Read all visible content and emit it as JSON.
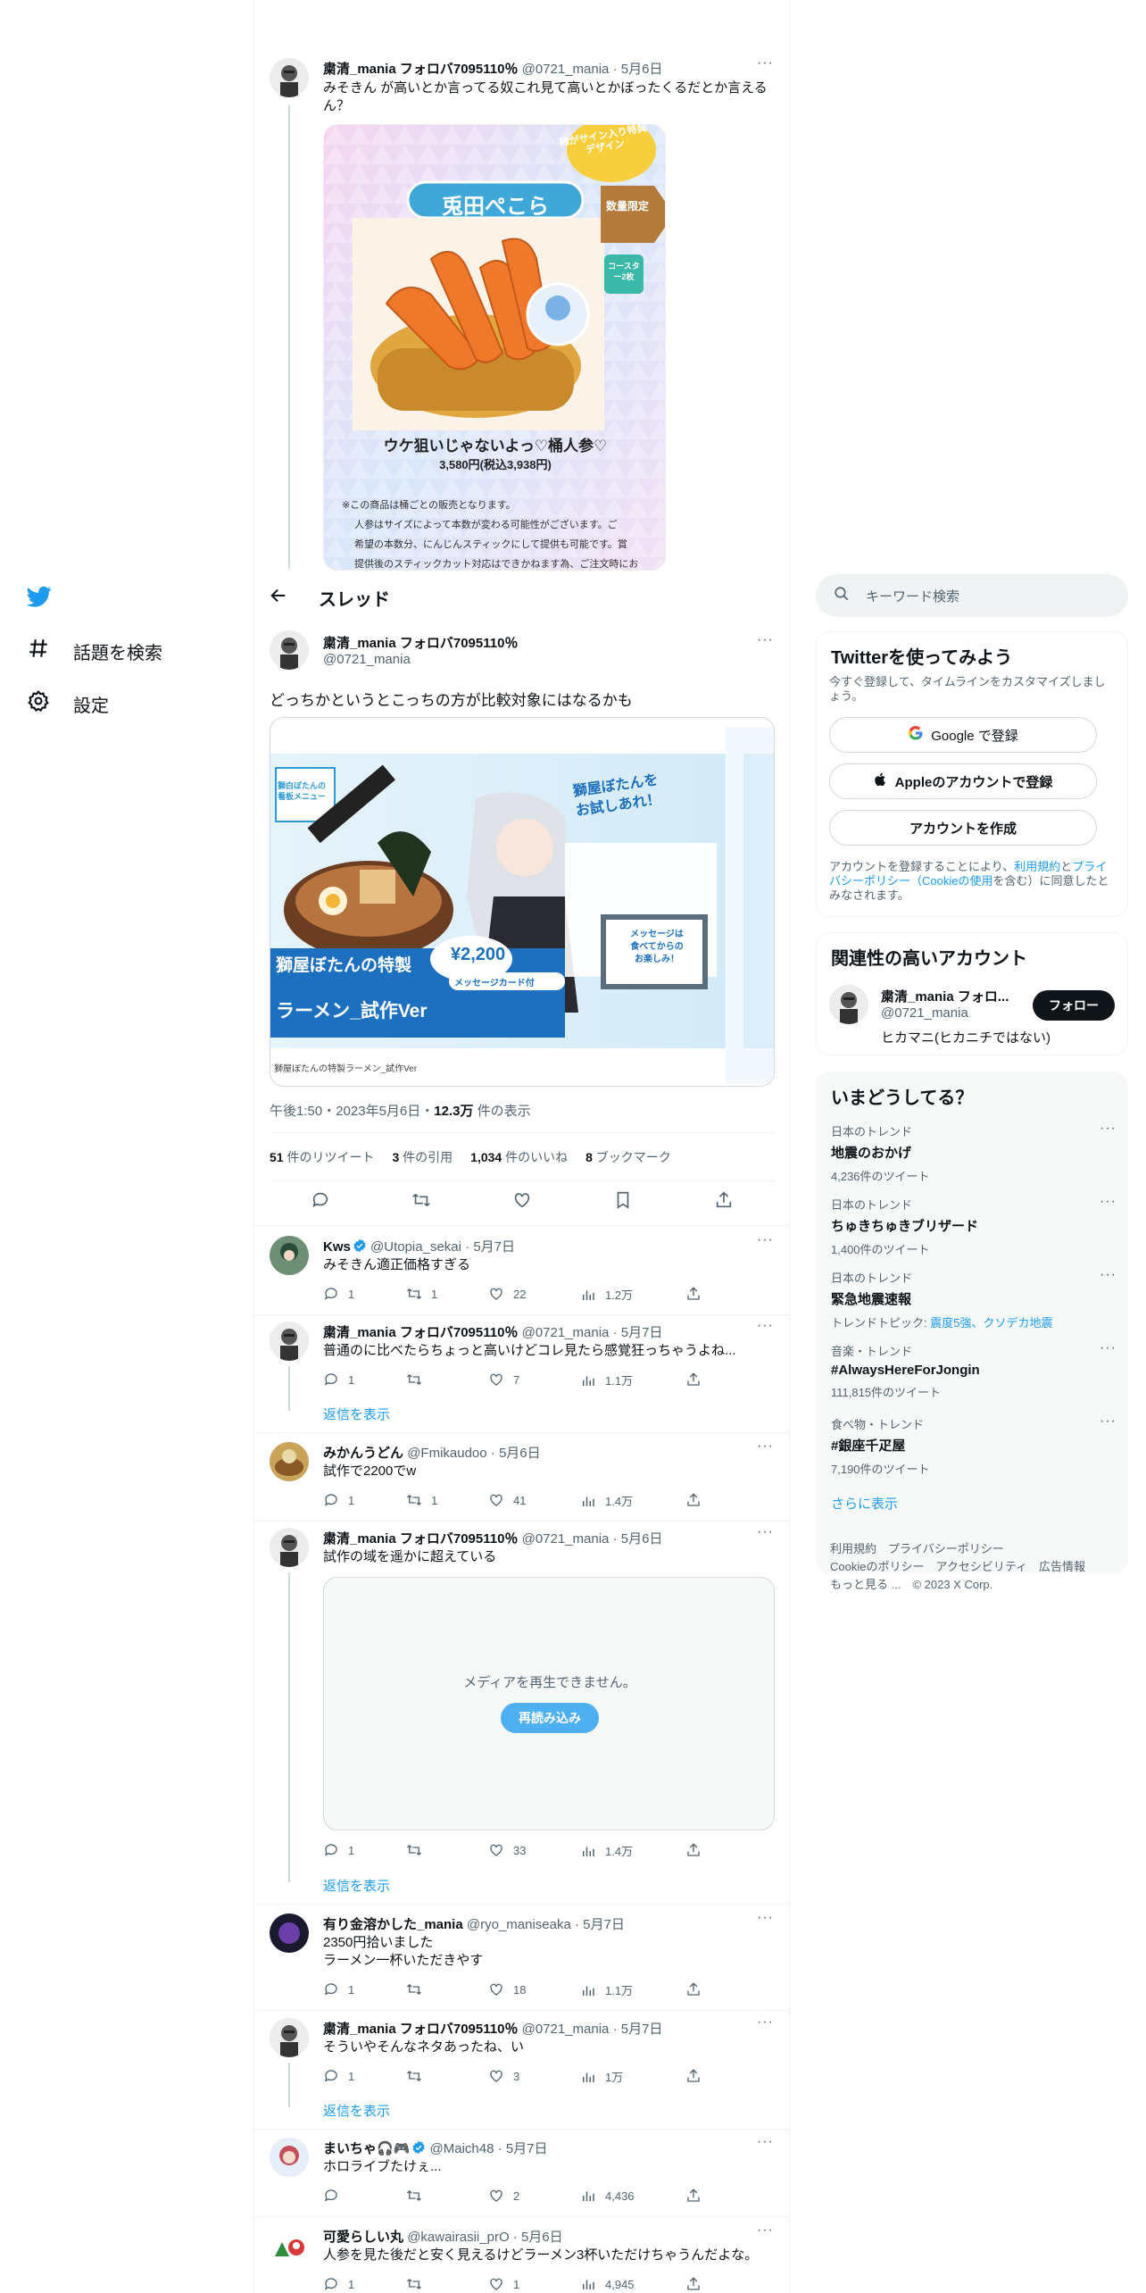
{
  "nav": {
    "explore_label": "話題を検索",
    "settings_label": "設定"
  },
  "thread_header": {
    "title": "スレッド"
  },
  "top_tweet": {
    "name": "粛清_mania フォロバ7095110％",
    "handle": "@0721_mania",
    "date": "5月6日",
    "text": "みそきん が高いとか言ってる奴これ見て高いとかぼったくるだとか言えるん？",
    "image": {
      "badge": "稀がサイン入り特典デザイン",
      "banner": "兎田ぺこら",
      "tag1": "数量限定",
      "tag2": "コースター2枚",
      "product": "ウケ狙いじゃないよっ♡桶人参♡",
      "price": "3,580円(税込3,938円)",
      "note1": "※この商品は桶ごとの販売となります。",
      "note2": "人参はサイズによって本数が変わる可能性がございます。ご",
      "note3": "希望の本数分、にんじんスティックにして提供も可能です。賞",
      "note4": "提供後のスティックカット対応はできかねます為、ご注文時にお"
    }
  },
  "main_tweet": {
    "name": "粛清_mania フォロバ7095110％",
    "handle": "@0721_mania",
    "text": "どっちかというとこっちの方が比較対象にはなるかも",
    "image": {
      "tag": "獅白ぼたんの\n看板メニュー",
      "headline": "獅屋ぼたんを\nお試しあれ！",
      "title1": "獅屋ぼたんの特製",
      "title2": "ラーメン_試作Ver",
      "price": "¥2,200",
      "sub": "メッセージカード付",
      "message": "メッセージは\n食べてからの\nお楽しみ！",
      "caption": "獅屋ぼたんの特製ラーメン_試作Ver"
    },
    "time": "午後1:50・2023年5月6日・",
    "views_num": "12.3万",
    "views_label": " 件の表示",
    "stats": {
      "retweets_num": "51",
      "retweets_label": " 件のリツイート",
      "quotes_num": "3",
      "quotes_label": " 件の引用",
      "likes_num": "1,034",
      "likes_label": " 件のいいね",
      "bookmarks_num": "8",
      "bookmarks_label": " ブックマーク"
    }
  },
  "replies": [
    {
      "name": "Kws",
      "handle": "@Utopia_sekai",
      "date": "5月7日",
      "text": "みそきん適正価格すぎる",
      "reply": "1",
      "rt": "1",
      "like": "22",
      "views": "1.2万"
    },
    {
      "name": "粛清_mania フォロバ7095110％",
      "handle": "@0721_mania",
      "date": "5月7日",
      "text": "普通のに比べたらちょっと高いけどコレ見たら感覚狂っちゃうよね...",
      "reply": "1",
      "rt": "",
      "like": "7",
      "views": "1.1万",
      "show_replies": "返信を表示"
    },
    {
      "name": "みかんうどん",
      "handle": "@Fmikaudoo",
      "date": "5月6日",
      "text": "試作で2200でw",
      "reply": "1",
      "rt": "1",
      "like": "41",
      "views": "1.4万"
    },
    {
      "name": "粛清_mania フォロバ7095110％",
      "handle": "@0721_mania",
      "date": "5月6日",
      "text": "試作の域を遥かに超えている",
      "media_error": "メディアを再生できません。",
      "reload": "再読み込み",
      "reply": "1",
      "rt": "",
      "like": "33",
      "views": "1.4万",
      "show_replies": "返信を表示"
    },
    {
      "name": "有り金溶かした_mania",
      "handle": "@ryo_maniseaka",
      "date": "5月7日",
      "text": "2350円拾いました\nラーメン一杯いただきやす",
      "reply": "1",
      "rt": "",
      "like": "18",
      "views": "1.1万"
    },
    {
      "name": "粛清_mania フォロバ7095110％",
      "handle": "@0721_mania",
      "date": "5月7日",
      "text": "そういやそんなネタあったね、い",
      "reply": "1",
      "rt": "",
      "like": "3",
      "views": "1万",
      "show_replies": "返信を表示"
    },
    {
      "name": "まいちゃ🎧🎮",
      "handle": "@Maich48",
      "date": "5月7日",
      "text": "ホロライブたけぇ...",
      "reply": "",
      "rt": "",
      "like": "2",
      "views": "4,436"
    },
    {
      "name": "可愛らしい丸",
      "handle": "@kawairasii_prO",
      "date": "5月6日",
      "text": "人参を見た後だと安く見えるけどラーメン3杯いただけちゃうんだよな。",
      "reply": "1",
      "rt": "",
      "like": "1",
      "views": "4,945"
    }
  ],
  "sidebar": {
    "search_placeholder": "キーワード検索",
    "signup": {
      "title": "Twitterを使ってみよう",
      "subtitle": "今すぐ登録して、タイムラインをカスタマイズしましょう。",
      "google_btn": "Google で登録",
      "apple_btn": "Appleのアカウントで登録",
      "create_btn": "アカウントを作成",
      "terms_a": "アカウントを登録することにより、",
      "terms_link1": "利用規約",
      "terms_b": "と",
      "terms_link2": "プライバシーポリシー（Cookieの使用",
      "terms_c": "を含む）に同意したとみなされます。"
    },
    "relevant": {
      "title": "関連性の高いアカウント",
      "name": "粛清_mania フォロ...",
      "handle": "@0721_mania",
      "bio": "ヒカマニ(ヒカニチではない)",
      "follow_btn": "フォロー"
    },
    "trends": {
      "title": "いまどうしてる？",
      "items": [
        {
          "cat": "日本のトレンド",
          "title": "地震のおかげ",
          "count": "4,236件のツイート"
        },
        {
          "cat": "日本のトレンド",
          "title": "ちゅきちゅきブリザード",
          "count": "1,400件のツイート"
        },
        {
          "cat": "日本のトレンド",
          "title": "緊急地震速報",
          "count_prefix": "トレンドトピック: ",
          "count_link": "震度5強、クソデカ地震"
        },
        {
          "cat": "音楽・トレンド",
          "title": "#AlwaysHereForJongin",
          "count": "111,815件のツイート"
        },
        {
          "cat": "食べ物・トレンド",
          "title": "#銀座千疋屋",
          "count": "7,190件のツイート"
        }
      ],
      "show_more": "さらに表示"
    },
    "footer": {
      "line1": "利用規約　プライバシーポリシー",
      "line2": "Cookieのポリシー　アクセシビリティ　広告情報",
      "line3": "もっと見る ...　© 2023 X Corp."
    }
  }
}
